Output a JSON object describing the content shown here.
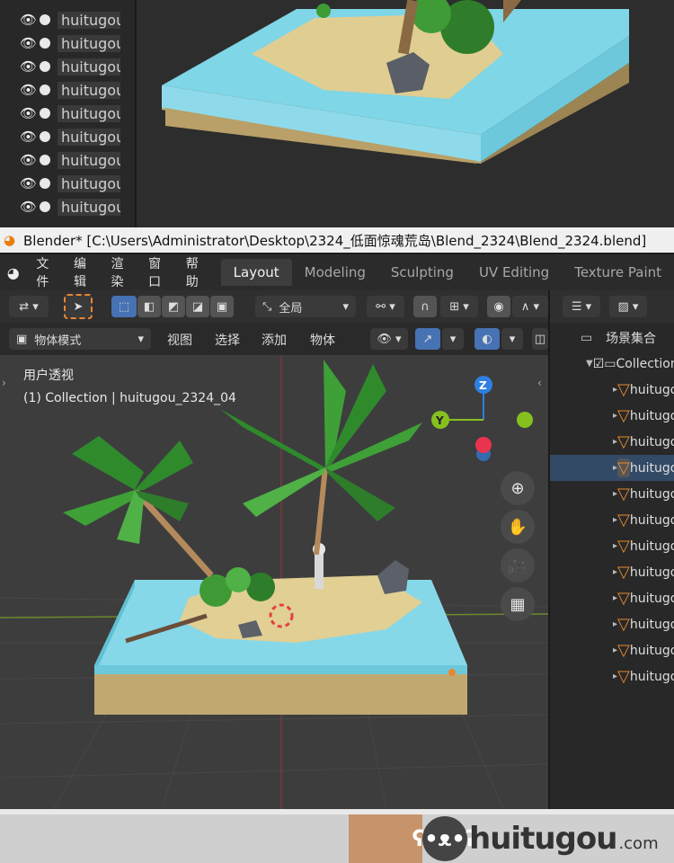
{
  "top_outliner": {
    "rows": [
      "huitugou",
      "huitugou",
      "huitugou",
      "huitugou",
      "huitugou",
      "huitugou",
      "huitugou",
      "huitugou",
      "huitugou"
    ]
  },
  "titlebar": {
    "text": "Blender* [C:\\Users\\Administrator\\Desktop\\2324_低面惊魂荒岛\\Blend_2324\\Blend_2324.blend]"
  },
  "menu": [
    "文件",
    "编辑",
    "渲染",
    "窗口",
    "帮助"
  ],
  "workspace_tabs": [
    "Layout",
    "Modeling",
    "Sculpting",
    "UV Editing",
    "Texture Paint"
  ],
  "active_tab": "Layout",
  "header": {
    "transform_orientation": "全局",
    "mode": "物体模式",
    "view": "视图",
    "select": "选择",
    "add": "添加",
    "object": "物体"
  },
  "viewport": {
    "view_name": "用户透视",
    "info": "(1) Collection | huitugou_2324_04"
  },
  "outliner": {
    "scene_collection": "场景集合",
    "collection": "Collection",
    "items": [
      "huitugou",
      "huitugou",
      "huitugou",
      "huitugou",
      "huitugou",
      "huitugou",
      "huitugou",
      "huitugou",
      "huitugou",
      "huitugou",
      "huitugou",
      "huitugou"
    ],
    "selected_index": 3
  },
  "banner": {
    "brand": "huitugou",
    "domain": ".com"
  },
  "colors": {
    "accent_blue": "#4772b3",
    "object_orange": "#e8872d",
    "axis_x": "#e8344e",
    "axis_y": "#85c01f",
    "axis_z": "#2f7fe0"
  }
}
